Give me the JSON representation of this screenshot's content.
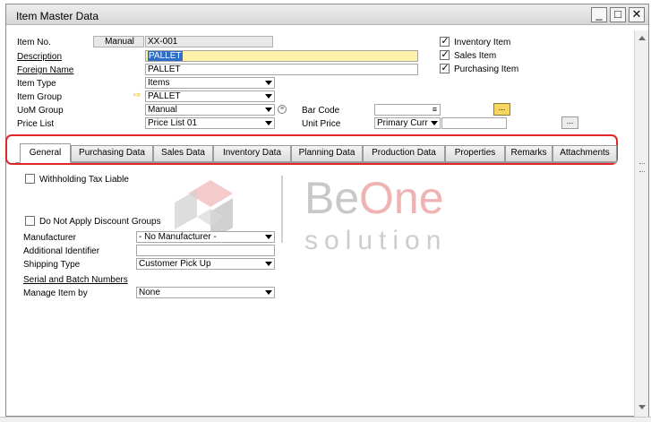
{
  "window": {
    "title": "Item Master Data"
  },
  "header": {
    "item_no": {
      "label": "Item No.",
      "series": "Manual",
      "value": "XX-001"
    },
    "description": {
      "label": "Description",
      "value": "PALLET"
    },
    "foreign_name": {
      "label": "Foreign Name",
      "value": "PALLET"
    },
    "item_type": {
      "label": "Item Type",
      "value": "Items"
    },
    "item_group": {
      "label": "Item Group",
      "value": "PALLET"
    },
    "uom_group": {
      "label": "UoM Group",
      "value": "Manual"
    },
    "price_list": {
      "label": "Price List",
      "value": "Price List 01"
    },
    "bar_code": {
      "label": "Bar Code",
      "value": "",
      "button": "..."
    },
    "unit_price": {
      "label": "Unit Price",
      "currency": "Primary Curr",
      "value": "",
      "button": "..."
    },
    "checkboxes": [
      {
        "label": "Inventory Item",
        "checked": true
      },
      {
        "label": "Sales Item",
        "checked": true
      },
      {
        "label": "Purchasing Item",
        "checked": true
      }
    ]
  },
  "tabs": [
    {
      "label": "General",
      "active": true
    },
    {
      "label": "Purchasing Data",
      "active": false
    },
    {
      "label": "Sales Data",
      "active": false
    },
    {
      "label": "Inventory Data",
      "active": false
    },
    {
      "label": "Planning Data",
      "active": false
    },
    {
      "label": "Production Data",
      "active": false
    },
    {
      "label": "Properties",
      "active": false
    },
    {
      "label": "Remarks",
      "active": false
    },
    {
      "label": "Attachments",
      "active": false
    }
  ],
  "general": {
    "withholding_tax": {
      "label": "Withholding Tax Liable",
      "checked": false
    },
    "no_discount": {
      "label": "Do Not Apply Discount Groups",
      "checked": false
    },
    "manufacturer": {
      "label": "Manufacturer",
      "value": "- No Manufacturer -"
    },
    "additional_identifier": {
      "label": "Additional Identifier",
      "value": ""
    },
    "shipping_type": {
      "label": "Shipping Type",
      "value": "Customer Pick Up"
    },
    "serial_batch": {
      "label": "Serial and Batch Numbers"
    },
    "manage_item_by": {
      "label": "Manage Item by",
      "value": "None"
    }
  },
  "watermark": {
    "brand_word_1": "Be",
    "brand_word_2": "One",
    "tagline": "solution"
  },
  "colors": {
    "highlight_frame": "#e1262a",
    "required_field": "#fff2a8",
    "selection": "#2f6ec7"
  }
}
